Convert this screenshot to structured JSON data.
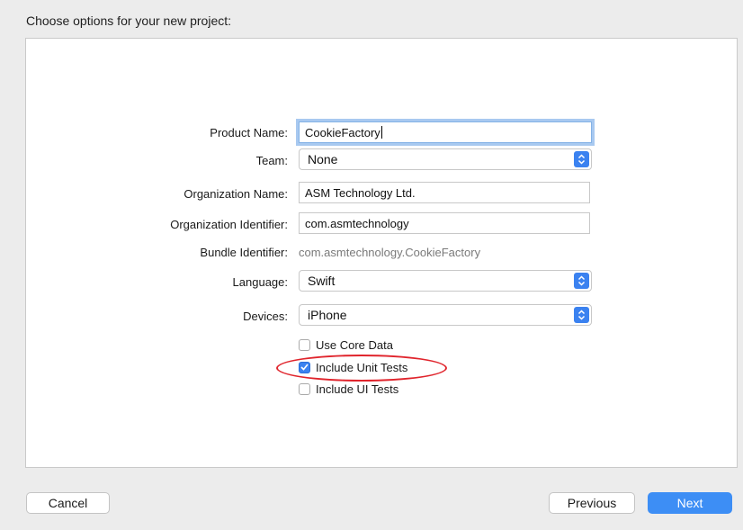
{
  "heading": "Choose options for your new project:",
  "form": {
    "product_name": {
      "label": "Product Name:",
      "value": "CookieFactory"
    },
    "team": {
      "label": "Team:",
      "value": "None"
    },
    "org_name": {
      "label": "Organization Name:",
      "value": "ASM Technology Ltd."
    },
    "org_id": {
      "label": "Organization Identifier:",
      "value": "com.asmtechnology"
    },
    "bundle_id": {
      "label": "Bundle Identifier:",
      "value": "com.asmtechnology.CookieFactory"
    },
    "language": {
      "label": "Language:",
      "value": "Swift"
    },
    "devices": {
      "label": "Devices:",
      "value": "iPhone"
    },
    "options": [
      {
        "label": "Use Core Data",
        "checked": false
      },
      {
        "label": "Include Unit Tests",
        "checked": true
      },
      {
        "label": "Include UI Tests",
        "checked": false
      }
    ]
  },
  "buttons": {
    "cancel": "Cancel",
    "previous": "Previous",
    "next": "Next"
  },
  "colors": {
    "accent": "#3b82f0",
    "annotation": "#e0242c"
  }
}
